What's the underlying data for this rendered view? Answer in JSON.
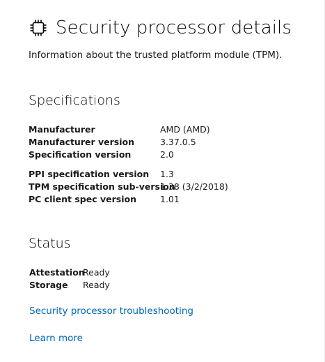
{
  "header": {
    "icon": "chip-icon",
    "title": "Security processor details"
  },
  "description": "Information about the trusted platform module (TPM).",
  "specifications": {
    "heading": "Specifications",
    "group1": [
      {
        "label": "Manufacturer",
        "value": "AMD (AMD)"
      },
      {
        "label": "Manufacturer version",
        "value": "3.37.0.5"
      },
      {
        "label": "Specification version",
        "value": "2.0"
      }
    ],
    "group2": [
      {
        "label": "PPI specification version",
        "value": "1.3"
      },
      {
        "label": "TPM specification sub-version",
        "value": "1.38 (3/2/2018)"
      },
      {
        "label": "PC client spec version",
        "value": "1.01"
      }
    ]
  },
  "status": {
    "heading": "Status",
    "items": [
      {
        "label": "Attestation",
        "value": "Ready"
      },
      {
        "label": "Storage",
        "value": "Ready"
      }
    ]
  },
  "links": {
    "troubleshooting": "Security processor troubleshooting",
    "learn_more": "Learn more"
  },
  "colors": {
    "link": "#0067b8"
  }
}
